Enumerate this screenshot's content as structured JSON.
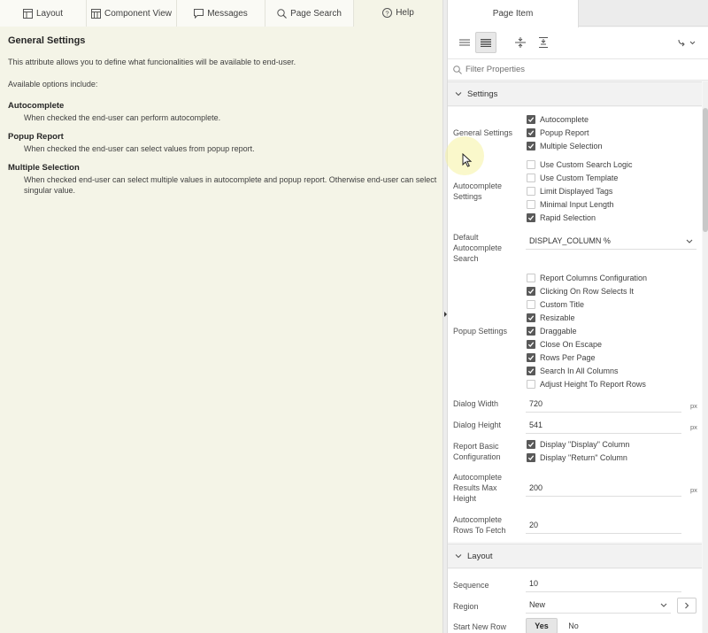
{
  "left_tabs": [
    {
      "label": "Layout",
      "icon": "layout-icon"
    },
    {
      "label": "Component View",
      "icon": "component-view-icon"
    },
    {
      "label": "Messages",
      "icon": "messages-icon"
    },
    {
      "label": "Page Search",
      "icon": "search-icon"
    },
    {
      "label": "Help",
      "icon": "help-icon"
    }
  ],
  "help": {
    "title": "General Settings",
    "intro": "This attribute allows you to define what funcionalities will be available to end-user.",
    "options_intro": "Available options include:",
    "items": [
      {
        "term": "Autocomplete",
        "def": "When checked the end-user can perform autocomplete."
      },
      {
        "term": "Popup Report",
        "def": "When checked the end-user can select values from popup report."
      },
      {
        "term": "Multiple Selection",
        "def": "When checked end-user can select multiple values in autocomplete and popup report. Otherwise end-user can select singular value."
      }
    ]
  },
  "right": {
    "tab_label": "Page Item",
    "filter_placeholder": "Filter Properties",
    "settings_group": "Settings",
    "layout_group": "Layout",
    "general_settings": {
      "label": "General Settings",
      "options": [
        {
          "label": "Autocomplete",
          "checked": true
        },
        {
          "label": "Popup Report",
          "checked": true
        },
        {
          "label": "Multiple Selection",
          "checked": true
        }
      ]
    },
    "autocomplete_settings": {
      "label": "Autocomplete Settings",
      "options": [
        {
          "label": "Use Custom Search Logic",
          "checked": false
        },
        {
          "label": "Use Custom Template",
          "checked": false
        },
        {
          "label": "Limit Displayed Tags",
          "checked": false
        },
        {
          "label": "Minimal Input Length",
          "checked": false
        },
        {
          "label": "Rapid Selection",
          "checked": true
        }
      ]
    },
    "default_autocomplete_search": {
      "label": "Default Autocomplete Search",
      "value": "DISPLAY_COLUMN %"
    },
    "popup_settings": {
      "label": "Popup Settings",
      "options": [
        {
          "label": "Report Columns Configuration",
          "checked": false
        },
        {
          "label": "Clicking On Row Selects It",
          "checked": true
        },
        {
          "label": "Custom Title",
          "checked": false
        },
        {
          "label": "Resizable",
          "checked": true
        },
        {
          "label": "Draggable",
          "checked": true
        },
        {
          "label": "Close On Escape",
          "checked": true
        },
        {
          "label": "Rows Per Page",
          "checked": true
        },
        {
          "label": "Search In All Columns",
          "checked": true
        },
        {
          "label": "Adjust Height To Report Rows",
          "checked": false
        }
      ]
    },
    "dialog_width": {
      "label": "Dialog Width",
      "value": "720",
      "unit": "px"
    },
    "dialog_height": {
      "label": "Dialog Height",
      "value": "541",
      "unit": "px"
    },
    "report_basic_config": {
      "label": "Report Basic Configuration",
      "options": [
        {
          "label": "Display \"Display\" Column",
          "checked": true
        },
        {
          "label": "Display \"Return\" Column",
          "checked": true
        }
      ]
    },
    "ac_max_height": {
      "label": "Autocomplete Results Max Height",
      "value": "200",
      "unit": "px"
    },
    "ac_rows_fetch": {
      "label": "Autocomplete Rows To Fetch",
      "value": "20"
    },
    "sequence": {
      "label": "Sequence",
      "value": "10"
    },
    "region": {
      "label": "Region",
      "value": "New"
    },
    "start_new_row": {
      "label": "Start New Row",
      "yes": "Yes",
      "no": "No",
      "selected": "Yes"
    }
  }
}
